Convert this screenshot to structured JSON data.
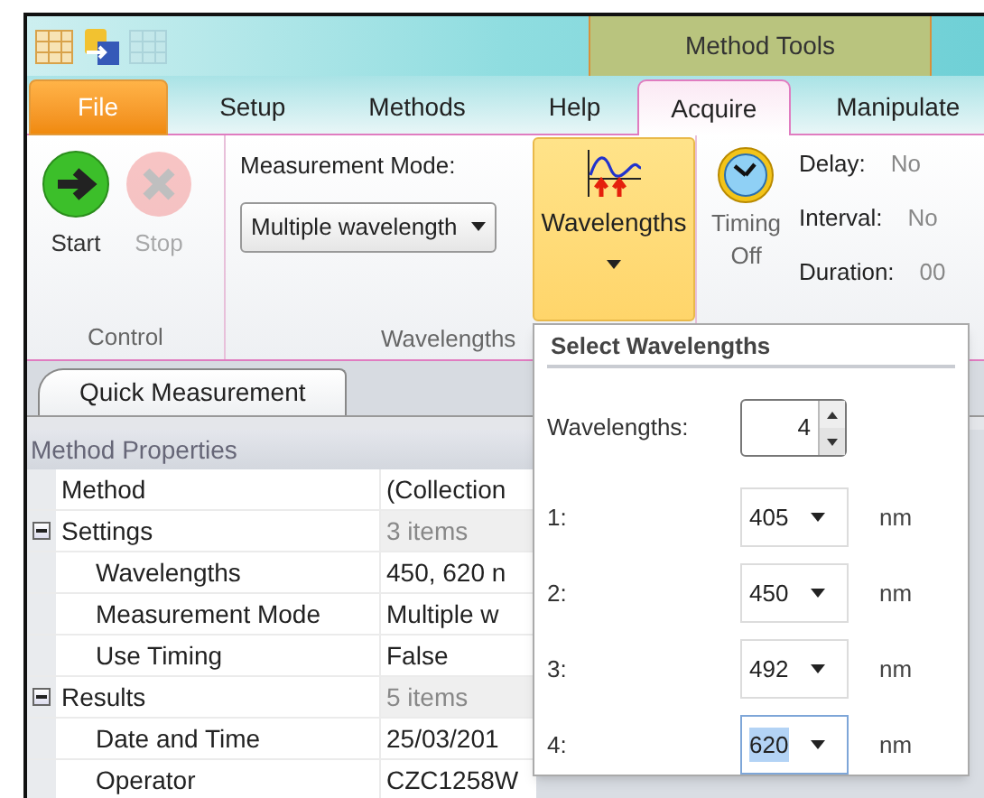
{
  "context_tab_header": {
    "title": "Method Tools"
  },
  "tabs": [
    {
      "label": "File",
      "kind": "file",
      "selected": false
    },
    {
      "label": "Setup",
      "kind": "tab",
      "selected": false
    },
    {
      "label": "Methods",
      "kind": "tab",
      "selected": false
    },
    {
      "label": "Help",
      "kind": "tab",
      "selected": false
    },
    {
      "label": "Acquire",
      "kind": "tab",
      "selected": true
    },
    {
      "label": "Manipulate",
      "kind": "tab",
      "selected": false
    }
  ],
  "ribbon": {
    "control_group": {
      "label": "Control",
      "buttons": [
        {
          "label": "Start",
          "kind": "start",
          "disabled": false
        },
        {
          "label": "Stop",
          "kind": "stop",
          "disabled": true
        }
      ]
    },
    "wavelengths_group": {
      "label": "Wavelengths",
      "mode_label": "Measurement Mode:",
      "mode_value": "Multiple wavelength",
      "button_label": "Wavelengths",
      "button_open": true
    },
    "timing": {
      "label_line_1": "Timing",
      "label_line_2": "Off",
      "fields": [
        {
          "label": "Delay:",
          "value": "No"
        },
        {
          "label": "Interval:",
          "value": "No"
        },
        {
          "label": "Duration:",
          "value": "00"
        }
      ]
    }
  },
  "document_tab": {
    "label": "Quick Measurement"
  },
  "properties": {
    "header": "Method Properties",
    "rows": [
      {
        "name": "Method",
        "value": "(Collection"
      },
      {
        "name": "Settings",
        "value": "3 items",
        "expanded": true,
        "children": [
          {
            "name": "Wavelengths",
            "value": "450, 620 n"
          },
          {
            "name": "Measurement Mode",
            "value": "Multiple w"
          },
          {
            "name": "Use Timing",
            "value": "False"
          }
        ]
      },
      {
        "name": "Results",
        "value": "5 items",
        "expanded": true,
        "children": [
          {
            "name": "Date and Time",
            "value": "25/03/201"
          },
          {
            "name": "Operator",
            "value": "CZC1258W"
          }
        ]
      }
    ]
  },
  "popup": {
    "title": "Select Wavelengths",
    "count_label": "Wavelengths:",
    "count_value": "4",
    "rows": [
      {
        "label": "1:",
        "value": "405",
        "unit": "nm",
        "selected": false
      },
      {
        "label": "2:",
        "value": "450",
        "unit": "nm",
        "selected": false
      },
      {
        "label": "3:",
        "value": "492",
        "unit": "nm",
        "selected": false
      },
      {
        "label": "4:",
        "value": "620",
        "unit": "nm",
        "selected": true
      }
    ]
  }
}
